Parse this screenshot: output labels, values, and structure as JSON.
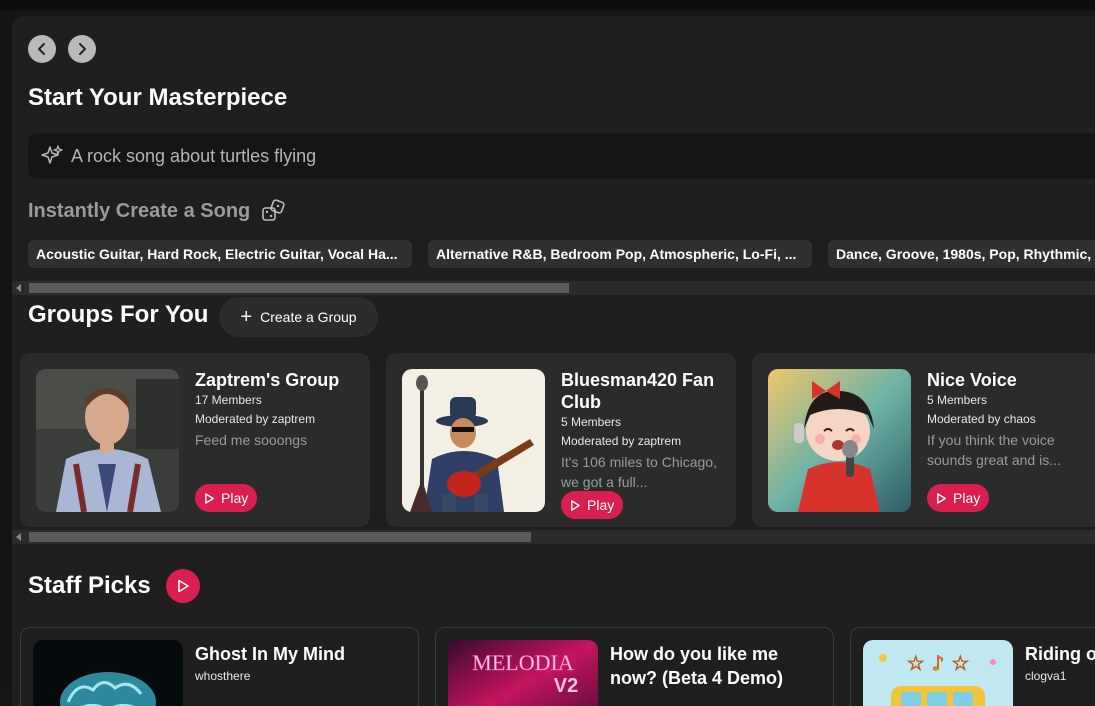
{
  "nav": {
    "back_label": "Back",
    "forward_label": "Forward"
  },
  "create": {
    "title": "Start Your Masterpiece",
    "prompt_placeholder": "A rock song about turtles flying",
    "instant_label": "Instantly Create a Song",
    "chips": [
      "Acoustic Guitar, Hard Rock, Electric Guitar, Vocal Ha...",
      "Alternative R&B, Bedroom Pop, Atmospheric, Lo-Fi, ...",
      "Dance, Groove, 1980s, Pop, Rhythmic,"
    ]
  },
  "groups": {
    "title": "Groups For You",
    "create_label": "Create a Group",
    "cards": [
      {
        "name": "Zaptrem's Group",
        "members": "17 Members",
        "moderator": "Moderated by zaptrem",
        "description": "Feed me sooongs",
        "play_label": "Play"
      },
      {
        "name": "Bluesman420 Fan Club",
        "members": "5 Members",
        "moderator": "Moderated by zaptrem",
        "description": "It's 106 miles to Chicago, we got a full...",
        "play_label": "Play"
      },
      {
        "name": "Nice Voice",
        "members": "5 Members",
        "moderator": "Moderated by chaos",
        "description": "If you think the voice sounds great and is...",
        "play_label": "Play"
      }
    ]
  },
  "staff": {
    "title": "Staff Picks",
    "cards": [
      {
        "title": "Ghost In My Mind",
        "artist": "whosthere"
      },
      {
        "title": "How do you like me now? (Beta 4 Demo)",
        "artist": "",
        "art_text": "MELODIA V2"
      },
      {
        "title": "Riding o",
        "artist": "clogva1"
      }
    ]
  },
  "colors": {
    "accent": "#d81f4f",
    "panel": "#1f1f1f",
    "card": "#2b2b2b"
  },
  "icons": [
    "chevron-left-icon",
    "chevron-right-icon",
    "sparkle-icon",
    "dice-icon",
    "plus-icon",
    "play-icon"
  ]
}
